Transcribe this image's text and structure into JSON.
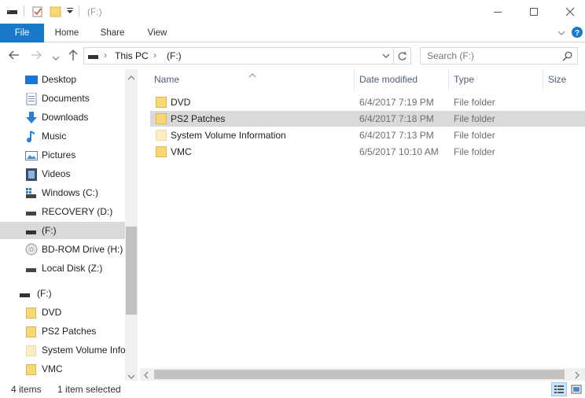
{
  "window": {
    "title": "(F:)"
  },
  "ribbon": {
    "tabs": [
      {
        "label": "File"
      },
      {
        "label": "Home"
      },
      {
        "label": "Share"
      },
      {
        "label": "View"
      }
    ]
  },
  "address": {
    "crumbs": [
      "This PC",
      "(F:)"
    ]
  },
  "search": {
    "placeholder": "Search  (F:)"
  },
  "nav": {
    "items": [
      {
        "label": "Desktop",
        "icon": "desktop-icon"
      },
      {
        "label": "Documents",
        "icon": "documents-icon"
      },
      {
        "label": "Downloads",
        "icon": "downloads-icon"
      },
      {
        "label": "Music",
        "icon": "music-icon"
      },
      {
        "label": "Pictures",
        "icon": "pictures-icon"
      },
      {
        "label": "Videos",
        "icon": "videos-icon"
      },
      {
        "label": "Windows (C:)",
        "icon": "windows-drive-icon"
      },
      {
        "label": "RECOVERY (D:)",
        "icon": "drive-icon"
      },
      {
        "label": " (F:)",
        "icon": "drive-icon"
      },
      {
        "label": "BD-ROM Drive (H:) ",
        "icon": "optical-drive-icon"
      },
      {
        "label": "Local Disk (Z:)",
        "icon": "drive-icon"
      },
      {
        "label": "(F:)",
        "icon": "drive-icon"
      },
      {
        "label": "DVD",
        "icon": "folder-icon"
      },
      {
        "label": "PS2 Patches",
        "icon": "folder-icon"
      },
      {
        "label": "System Volume Info",
        "icon": "folder-faded-icon"
      },
      {
        "label": "VMC",
        "icon": "folder-icon"
      }
    ]
  },
  "columns": {
    "name": "Name",
    "date": "Date modified",
    "type": "Type",
    "size": "Size"
  },
  "files": [
    {
      "name": "DVD",
      "date": "6/4/2017 7:19 PM",
      "type": "File folder"
    },
    {
      "name": "PS2 Patches",
      "date": "6/4/2017 7:18 PM",
      "type": "File folder"
    },
    {
      "name": "System Volume Information",
      "date": "6/4/2017 7:13 PM",
      "type": "File folder"
    },
    {
      "name": "VMC",
      "date": "6/5/2017 10:10 AM",
      "type": "File folder"
    }
  ],
  "status": {
    "count": "4 items",
    "selected": "1 item selected"
  },
  "colors": {
    "accent": "#1979ca",
    "folder": "#f8d775",
    "selection": "#d9d9d9"
  }
}
